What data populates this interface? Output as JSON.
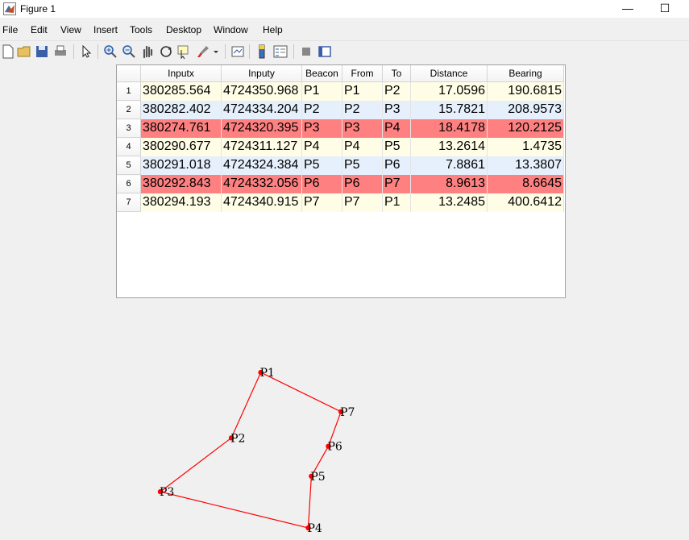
{
  "window": {
    "title": "Figure 1",
    "minimize": "—",
    "maximize": "☐"
  },
  "menu": [
    "File",
    "Edit",
    "View",
    "Insert",
    "Tools",
    "Desktop",
    "Window",
    "Help"
  ],
  "toolbar_icons": [
    "new-figure-icon",
    "open-file-icon",
    "save-icon",
    "print-icon",
    "pointer-icon",
    "zoom-in-icon",
    "zoom-out-icon",
    "pan-icon",
    "rotate-3d-icon",
    "data-cursor-icon",
    "brush-icon",
    "dropdown-arrow-icon",
    "link-plot-icon",
    "insert-colorbar-icon",
    "insert-legend-icon",
    "hide-plot-tools-icon",
    "show-plot-tools-icon"
  ],
  "table": {
    "columns": [
      "Inputx",
      "Inputy",
      "Beacon",
      "From",
      "To",
      "Distance",
      "Bearing"
    ],
    "rows": [
      {
        "n": "1",
        "x": "380285.564",
        "y": "4724350.968",
        "beacon": "P1",
        "from": "P1",
        "to": "P2",
        "distance": "17.0596",
        "bearing": "190.6815",
        "color": "yellow"
      },
      {
        "n": "2",
        "x": "380282.402",
        "y": "4724334.204",
        "beacon": "P2",
        "from": "P2",
        "to": "P3",
        "distance": "15.7821",
        "bearing": "208.9573",
        "color": "blue"
      },
      {
        "n": "3",
        "x": "380274.761",
        "y": "4724320.395",
        "beacon": "P3",
        "from": "P3",
        "to": "P4",
        "distance": "18.4178",
        "bearing": "120.2125",
        "color": "red"
      },
      {
        "n": "4",
        "x": "380290.677",
        "y": "4724311.127",
        "beacon": "P4",
        "from": "P4",
        "to": "P5",
        "distance": "13.2614",
        "bearing": "1.4735",
        "color": "yellow"
      },
      {
        "n": "5",
        "x": "380291.018",
        "y": "4724324.384",
        "beacon": "P5",
        "from": "P5",
        "to": "P6",
        "distance": "7.8861",
        "bearing": "13.3807",
        "color": "blue"
      },
      {
        "n": "6",
        "x": "380292.843",
        "y": "4724332.056",
        "beacon": "P6",
        "from": "P6",
        "to": "P7",
        "distance": "8.9613",
        "bearing": "8.6645",
        "color": "red"
      },
      {
        "n": "7",
        "x": "380294.193",
        "y": "4724340.915",
        "beacon": "P7",
        "from": "P7",
        "to": "P1",
        "distance": "13.2485",
        "bearing": "400.6412",
        "color": "yellow"
      }
    ]
  },
  "plot": {
    "type": "scatter",
    "line_color": "#ff0000",
    "marker_color": "#ff0000",
    "closed": true,
    "points": [
      {
        "label": "P1",
        "x": 380285.564,
        "y": 4724350.968
      },
      {
        "label": "P2",
        "x": 380282.402,
        "y": 4724334.204
      },
      {
        "label": "P3",
        "x": 380274.761,
        "y": 4724320.395
      },
      {
        "label": "P4",
        "x": 380290.677,
        "y": 4724311.127
      },
      {
        "label": "P5",
        "x": 380291.018,
        "y": 4724324.384
      },
      {
        "label": "P6",
        "x": 380292.843,
        "y": 4724332.056
      },
      {
        "label": "P7",
        "x": 380294.193,
        "y": 4724340.915
      }
    ]
  }
}
